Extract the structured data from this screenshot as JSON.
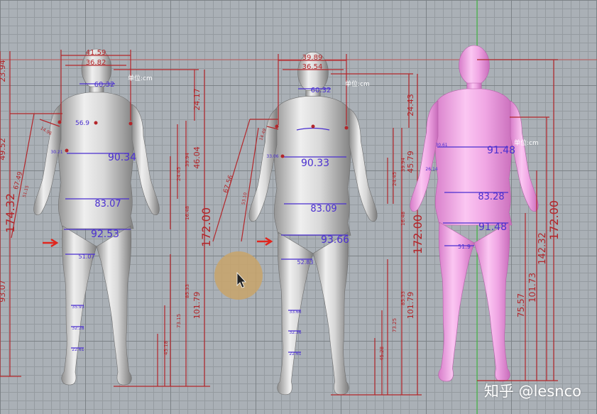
{
  "unit_label": "单位:cm",
  "watermark": "知乎 @lesnco",
  "colors": {
    "girth": "#4a2fd0",
    "dimension": "#b3262a",
    "grey_model": "#d9d9d9",
    "pink_model": "#f0a6e4",
    "arrow": "#e0261e",
    "cursor_halo": "#c9a46a"
  },
  "model1": {
    "shoulder_widths": [
      "41.59",
      "36.82"
    ],
    "heights": [
      "24.17",
      "46.04",
      "172.00",
      "101.79"
    ],
    "small_heights": [
      "39.94",
      "24.45",
      "16.48",
      "85.33",
      "73.15",
      "45.18"
    ],
    "left_dims": [
      "23.94",
      "49.52",
      "67.49",
      "174.32",
      "93.07"
    ],
    "arm_dims": [
      "51.15",
      "14.96",
      "30.21",
      "56.9"
    ],
    "girths": {
      "head": "60.32",
      "chest": "90.34",
      "waist": "83.07",
      "hip": "92.53",
      "thigh": "51.07"
    },
    "small_girths": [
      "35.93",
      "32.28",
      "22.61"
    ]
  },
  "model2": {
    "shoulder_widths": [
      "39.89",
      "36.54"
    ],
    "heights": [
      "24.43",
      "45.79",
      "172.00",
      "101.79"
    ],
    "small_heights": [
      "39.94",
      "24.45",
      "16.48",
      "85.33",
      "73.25",
      "45.28"
    ],
    "left_dims": [
      "67.56",
      "53.10",
      "14.49",
      "33.06"
    ],
    "girths": {
      "head": "60.32",
      "chest": "90.33",
      "waist": "83.09",
      "hip": "93.66",
      "thigh": "52.83"
    },
    "small_girths": [
      "33.66",
      "32.36",
      "22.61"
    ]
  },
  "model3": {
    "heights": [
      "172.00",
      "142.32",
      "101.73",
      "75.57"
    ],
    "girths": {
      "chest": "91.48",
      "waist": "83.28",
      "hip": "91.48",
      "thigh": "51.9"
    },
    "arm_girths": [
      "30.61",
      "26.14"
    ]
  }
}
